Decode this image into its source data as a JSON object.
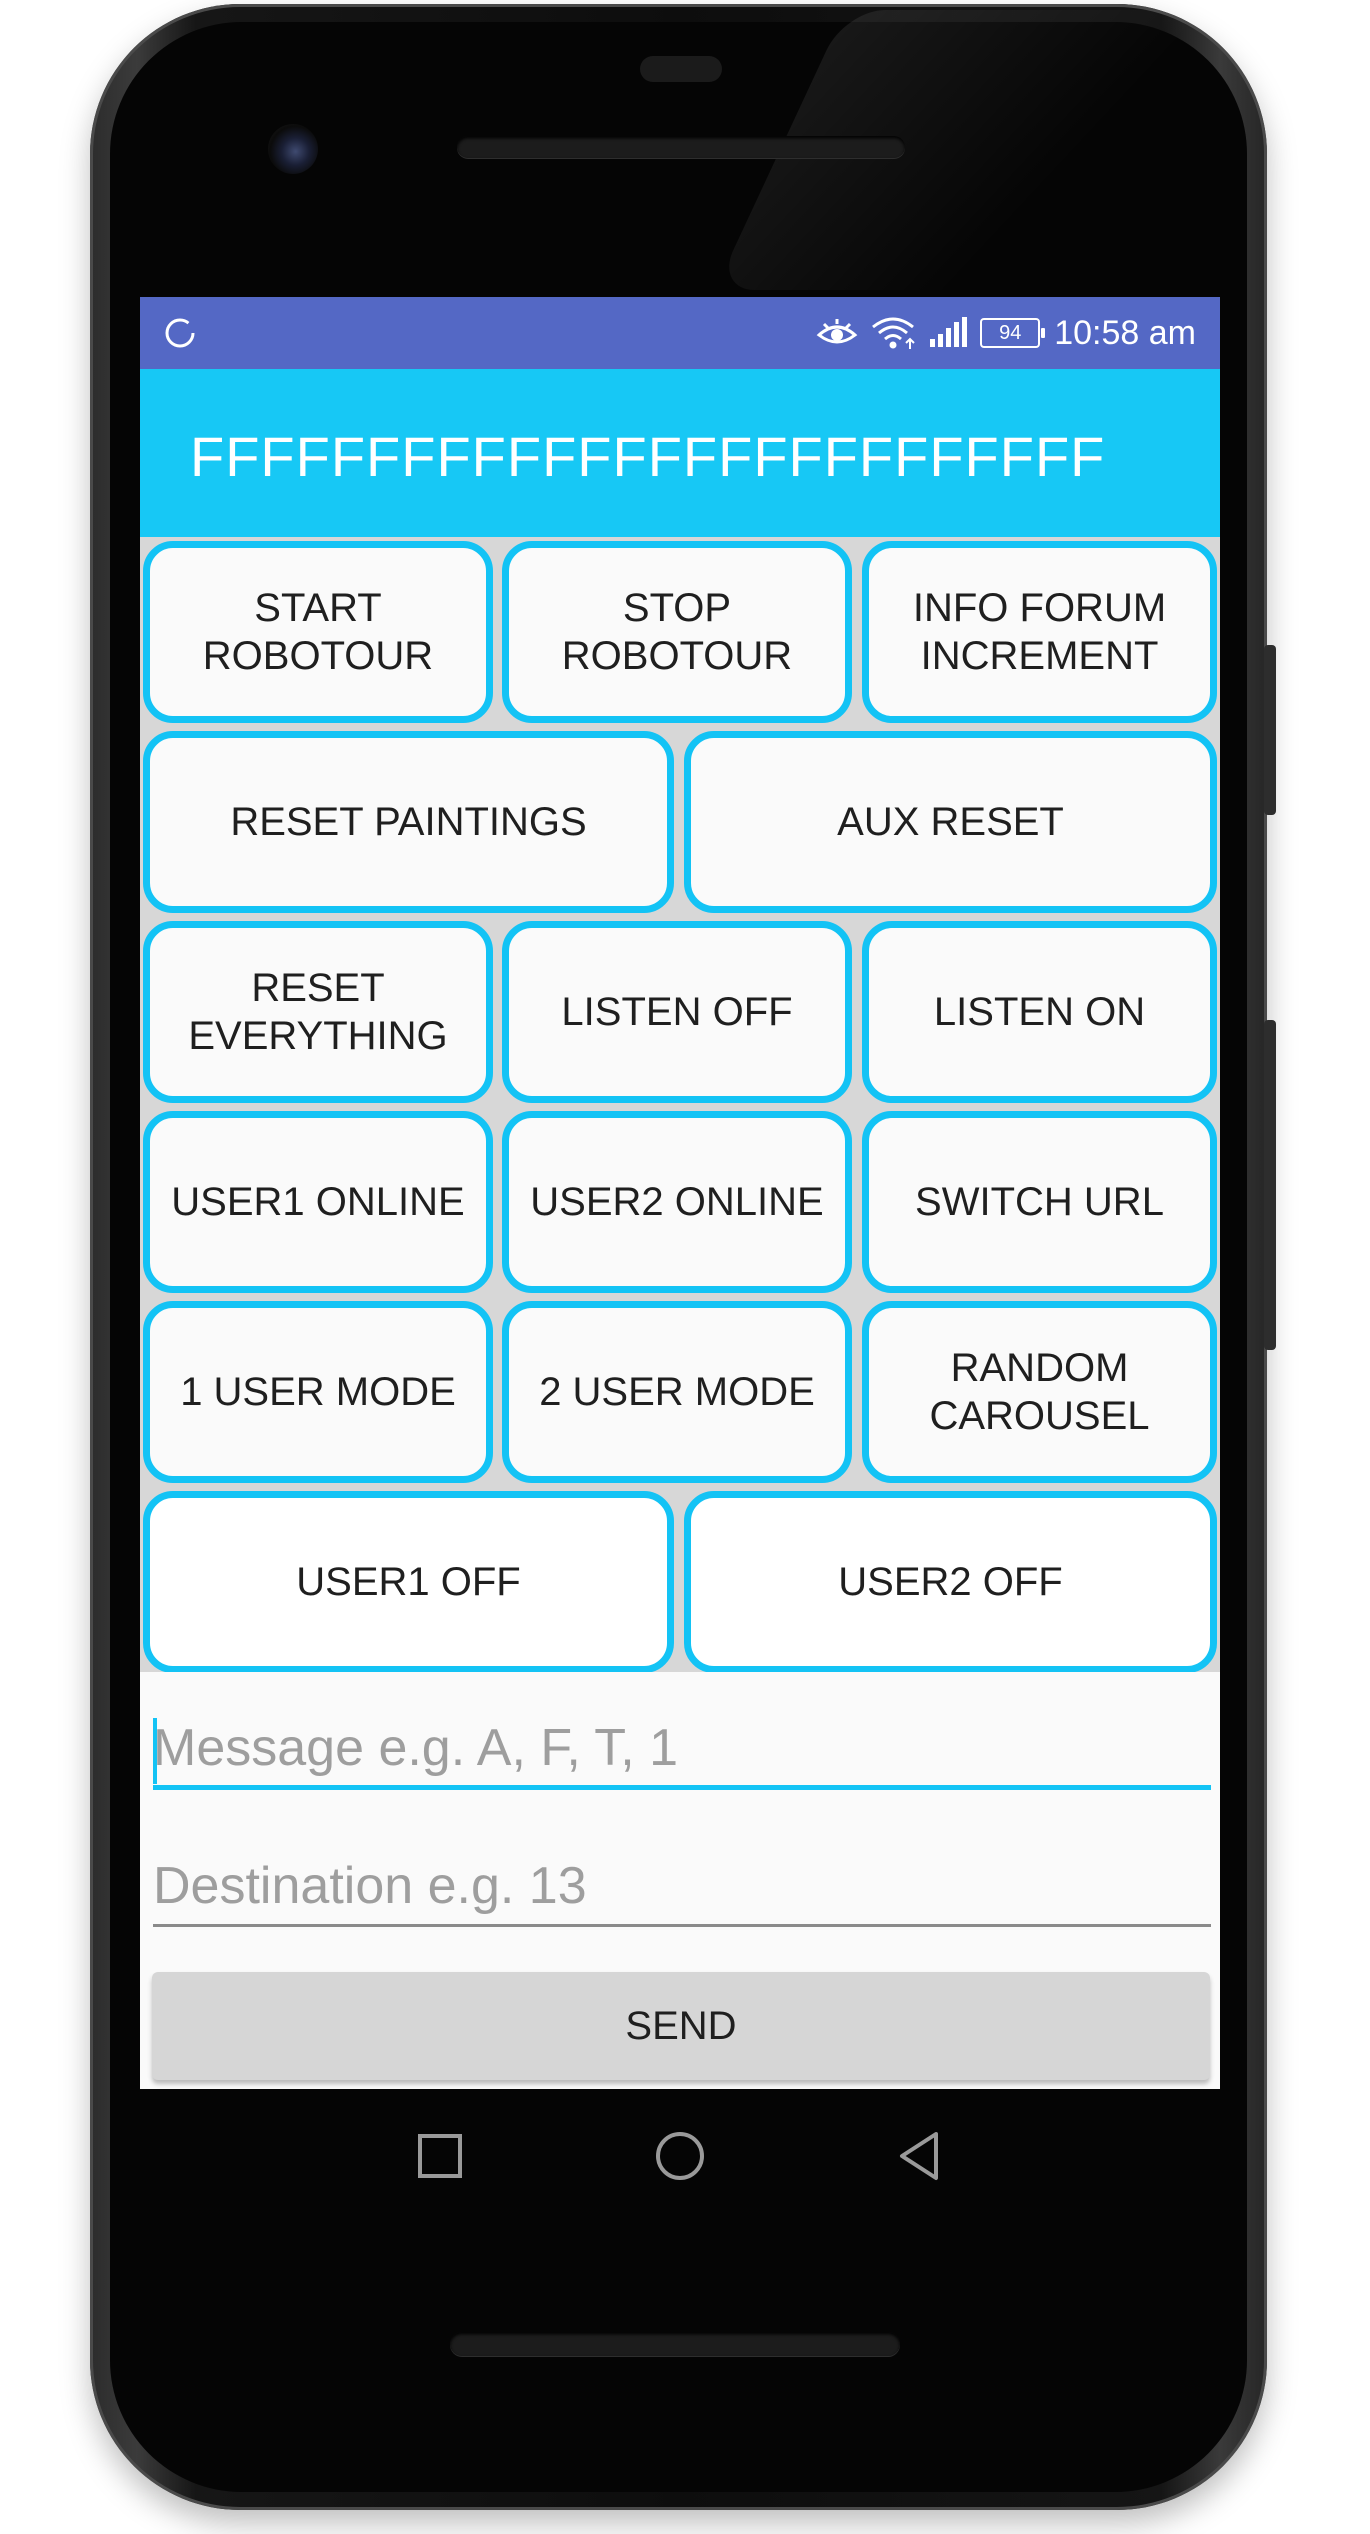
{
  "status_bar": {
    "battery_level": "94",
    "time": "10:58 am",
    "color": "#5468c5"
  },
  "app_bar": {
    "title": "FFFFFFFFFFFFFFFFFFFFFFFFFF",
    "color": "#17c8f5"
  },
  "buttons": {
    "start_robotour": "START\nROBOTOUR",
    "stop_robotour": "STOP\nROBOTOUR",
    "info_forum_increment": "INFO FORUM\nINCREMENT",
    "reset_paintings": "RESET PAINTINGS",
    "aux_reset": "AUX RESET",
    "reset_everything": "RESET\nEVERYTHING",
    "listen_off": "LISTEN OFF",
    "listen_on": "LISTEN ON",
    "user1_online": "USER1 ONLINE",
    "user2_online": "USER2 ONLINE",
    "switch_url": "SWITCH URL",
    "one_user_mode": "1 USER MODE",
    "two_user_mode": "2 USER MODE",
    "random_carousel": "RANDOM\nCAROUSEL",
    "user1_off": "USER1 OFF",
    "user2_off": "USER2 OFF",
    "border_color": "#13c3f5"
  },
  "form": {
    "message_placeholder": "Message e.g. A, F, T, 1",
    "message_value": "",
    "destination_placeholder": "Destination e.g. 13",
    "destination_value": "",
    "send_label": "SEND"
  },
  "nav_bar": {
    "icons": [
      "recents-icon",
      "home-icon",
      "back-icon"
    ]
  }
}
